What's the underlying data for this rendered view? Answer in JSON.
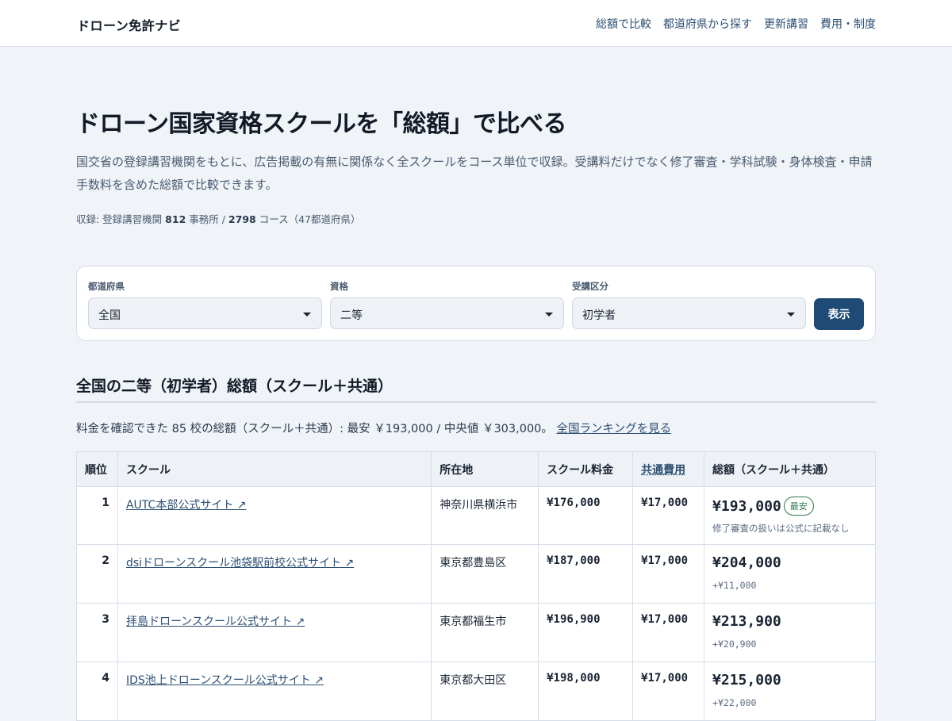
{
  "header": {
    "brand": "ドローン免許ナビ",
    "nav": [
      "総額で比較",
      "都道府県から探す",
      "更新講習",
      "費用・制度"
    ]
  },
  "hero": {
    "title": "ドローン国家資格スクールを「総額」で比べる",
    "lead": "国交省の登録講習機関をもとに、広告掲載の有無に関係なく全スクールをコース単位で収録。受講料だけでなく修了審査・学科試験・身体検査・申請手数料を含めた総額で比較できます。",
    "stats": {
      "prefix": "収録: 登録講習機関",
      "offices": "812",
      "offices_unit": "事務所 /",
      "courses": "2798",
      "courses_unit": "コース（47都道府県）"
    }
  },
  "filters": {
    "prefecture": {
      "label": "都道府県",
      "value": "全国"
    },
    "license": {
      "label": "資格",
      "value": "二等"
    },
    "category": {
      "label": "受講区分",
      "value": "初学者"
    },
    "submit_label": "表示"
  },
  "results": {
    "title": "全国の二等（初学者）総額（スクール＋共通）",
    "summary": "料金を確認できた 85 校の総額（スクール＋共通）: 最安 ￥193,000 / 中央値 ￥303,000。",
    "ranking_link": "全国ランキングを見る",
    "columns": [
      "順位",
      "スクール",
      "所在地",
      "スクール料金",
      "共通費用",
      "総額（スクール＋共通）"
    ],
    "rows": [
      {
        "rank": "1",
        "school": "AUTC本部公式サイト ↗",
        "location": "神奈川県横浜市",
        "school_fee": "¥176,000",
        "common_fee": "¥17,000",
        "total": "¥193,000",
        "badge": "最安",
        "note": "修了審査の扱いは公式に記載なし"
      },
      {
        "rank": "2",
        "school": "dsiドローンスクール池袋駅前校公式サイト ↗",
        "location": "東京都豊島区",
        "school_fee": "¥187,000",
        "common_fee": "¥17,000",
        "total": "¥204,000",
        "diff": "+¥11,000"
      },
      {
        "rank": "3",
        "school": "拝島ドローンスクール公式サイト ↗",
        "location": "東京都福生市",
        "school_fee": "¥196,900",
        "common_fee": "¥17,000",
        "total": "¥213,900",
        "diff": "+¥20,900"
      },
      {
        "rank": "4",
        "school": "IDS池上ドローンスクール公式サイト ↗",
        "location": "東京都大田区",
        "school_fee": "¥198,000",
        "common_fee": "¥17,000",
        "total": "¥215,000",
        "diff": "+¥22,000"
      }
    ]
  }
}
